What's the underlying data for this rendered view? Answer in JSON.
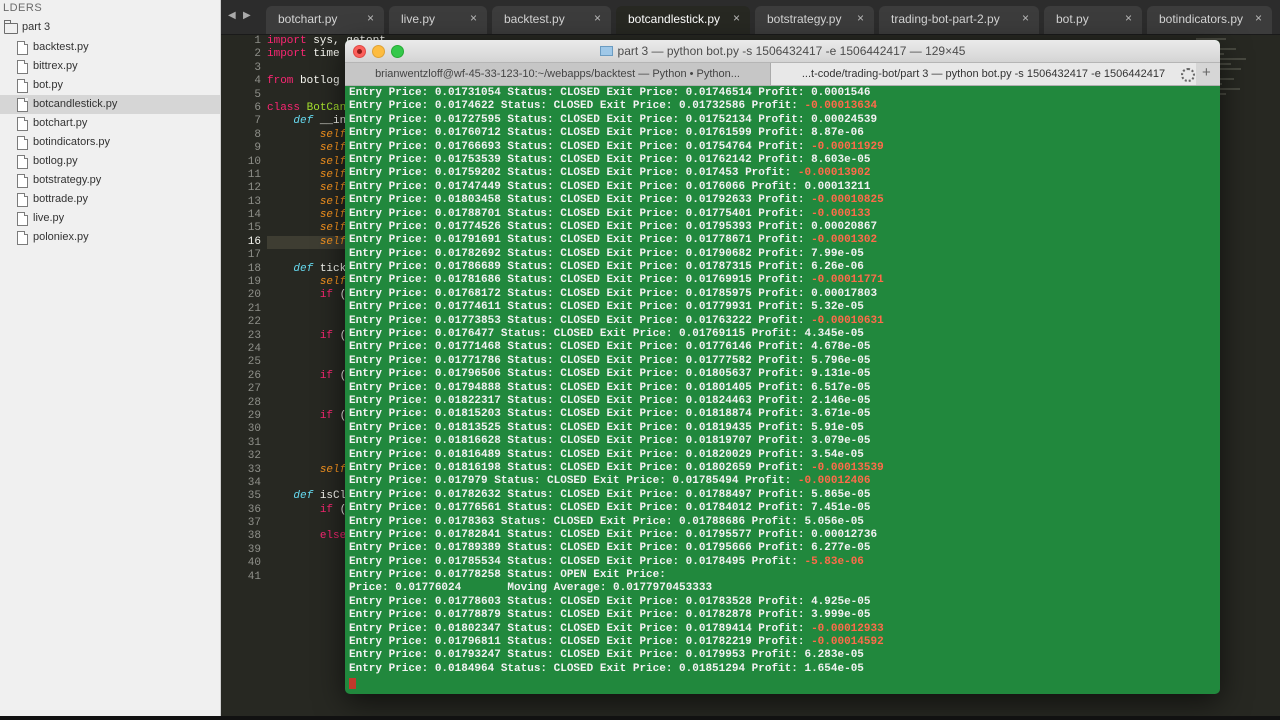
{
  "sidebar": {
    "header": "LDERS",
    "folder": "part 3",
    "files": [
      {
        "label": "backtest.py",
        "active": false
      },
      {
        "label": "bittrex.py",
        "active": false
      },
      {
        "label": "bot.py",
        "active": false
      },
      {
        "label": "botcandlestick.py",
        "active": true
      },
      {
        "label": "botchart.py",
        "active": false
      },
      {
        "label": "botindicators.py",
        "active": false
      },
      {
        "label": "botlog.py",
        "active": false
      },
      {
        "label": "botstrategy.py",
        "active": false
      },
      {
        "label": "bottrade.py",
        "active": false
      },
      {
        "label": "live.py",
        "active": false
      },
      {
        "label": "poloniex.py",
        "active": false
      }
    ]
  },
  "tabs": [
    {
      "label": "botchart.py",
      "active": false
    },
    {
      "label": "live.py",
      "active": false
    },
    {
      "label": "backtest.py",
      "active": false
    },
    {
      "label": "botcandlestick.py",
      "active": true
    },
    {
      "label": "botstrategy.py",
      "active": false
    },
    {
      "label": "trading-bot-part-2.py",
      "active": false
    },
    {
      "label": "bot.py",
      "active": false
    },
    {
      "label": "botindicators.py",
      "active": false
    }
  ],
  "editor": {
    "line_numbers": [
      "1",
      "2",
      "3",
      "4",
      "5",
      "6",
      "7",
      "8",
      "9",
      "10",
      "11",
      "12",
      "13",
      "14",
      "15",
      "16",
      "17",
      "18",
      "19",
      "20",
      "21",
      "22",
      "23",
      "24",
      "25",
      "26",
      "27",
      "28",
      "29",
      "30",
      "31",
      "32",
      "33",
      "34",
      "35",
      "36",
      "37",
      "38",
      "39",
      "40",
      "41"
    ],
    "current_line": "16",
    "code_lines": [
      "import sys, getopt",
      "import time",
      "",
      "from botlog",
      "",
      "class BotCan",
      "    def __in",
      "        self",
      "        self",
      "        self",
      "        self",
      "        self",
      "        self",
      "        self",
      "        self",
      "        self",
      "",
      "    def tick",
      "        self",
      "        if (",
      "",
      "",
      "        if (",
      "",
      "",
      "        if (",
      "",
      "",
      "        if (",
      "",
      "",
      "",
      "        self",
      "",
      "    def isCl",
      "        if (",
      "",
      "        else",
      "",
      "",
      ""
    ]
  },
  "terminal": {
    "title": "part 3 — python bot.py -s 1506432417 -e 1506442417 — 129×45",
    "tab_inactive": "brianwentzloff@wf-45-33-123-10:~/webapps/backtest — Python • Python...",
    "tab_active": "...t-code/trading-bot/part 3 — python bot.py -s 1506432417 -e 1506442417",
    "lines": [
      {
        "text": "Entry Price: 0.01731054 Status: CLOSED Exit Price: 0.01746514 Profit: ",
        "profit": "0.0001546",
        "neg": false
      },
      {
        "text": "Entry Price: 0.0174622 Status: CLOSED Exit Price: 0.01732586 Profit: ",
        "profit": "-0.00013634",
        "neg": true
      },
      {
        "text": "Entry Price: 0.01727595 Status: CLOSED Exit Price: 0.01752134 Profit: ",
        "profit": "0.00024539",
        "neg": false
      },
      {
        "text": "Entry Price: 0.01760712 Status: CLOSED Exit Price: 0.01761599 Profit: ",
        "profit": "8.87e-06",
        "neg": false
      },
      {
        "text": "Entry Price: 0.01766693 Status: CLOSED Exit Price: 0.01754764 Profit: ",
        "profit": "-0.00011929",
        "neg": true
      },
      {
        "text": "Entry Price: 0.01753539 Status: CLOSED Exit Price: 0.01762142 Profit: ",
        "profit": "8.603e-05",
        "neg": false
      },
      {
        "text": "Entry Price: 0.01759202 Status: CLOSED Exit Price: 0.017453 Profit: ",
        "profit": "-0.00013902",
        "neg": true
      },
      {
        "text": "Entry Price: 0.01747449 Status: CLOSED Exit Price: 0.0176066 Profit: ",
        "profit": "0.00013211",
        "neg": false
      },
      {
        "text": "Entry Price: 0.01803458 Status: CLOSED Exit Price: 0.01792633 Profit: ",
        "profit": "-0.00010825",
        "neg": true
      },
      {
        "text": "Entry Price: 0.01788701 Status: CLOSED Exit Price: 0.01775401 Profit: ",
        "profit": "-0.000133",
        "neg": true
      },
      {
        "text": "Entry Price: 0.01774526 Status: CLOSED Exit Price: 0.01795393 Profit: ",
        "profit": "0.00020867",
        "neg": false
      },
      {
        "text": "Entry Price: 0.01791691 Status: CLOSED Exit Price: 0.01778671 Profit: ",
        "profit": "-0.0001302",
        "neg": true
      },
      {
        "text": "Entry Price: 0.01782692 Status: CLOSED Exit Price: 0.01790682 Profit: ",
        "profit": "7.99e-05",
        "neg": false
      },
      {
        "text": "Entry Price: 0.01786689 Status: CLOSED Exit Price: 0.01787315 Profit: ",
        "profit": "6.26e-06",
        "neg": false
      },
      {
        "text": "Entry Price: 0.01781686 Status: CLOSED Exit Price: 0.01769915 Profit: ",
        "profit": "-0.00011771",
        "neg": true
      },
      {
        "text": "Entry Price: 0.01768172 Status: CLOSED Exit Price: 0.01785975 Profit: ",
        "profit": "0.00017803",
        "neg": false
      },
      {
        "text": "Entry Price: 0.01774611 Status: CLOSED Exit Price: 0.01779931 Profit: ",
        "profit": "5.32e-05",
        "neg": false
      },
      {
        "text": "Entry Price: 0.01773853 Status: CLOSED Exit Price: 0.01763222 Profit: ",
        "profit": "-0.00010631",
        "neg": true
      },
      {
        "text": "Entry Price: 0.0176477 Status: CLOSED Exit Price: 0.01769115 Profit: ",
        "profit": "4.345e-05",
        "neg": false
      },
      {
        "text": "Entry Price: 0.01771468 Status: CLOSED Exit Price: 0.01776146 Profit: ",
        "profit": "4.678e-05",
        "neg": false
      },
      {
        "text": "Entry Price: 0.01771786 Status: CLOSED Exit Price: 0.01777582 Profit: ",
        "profit": "5.796e-05",
        "neg": false
      },
      {
        "text": "Entry Price: 0.01796506 Status: CLOSED Exit Price: 0.01805637 Profit: ",
        "profit": "9.131e-05",
        "neg": false
      },
      {
        "text": "Entry Price: 0.01794888 Status: CLOSED Exit Price: 0.01801405 Profit: ",
        "profit": "6.517e-05",
        "neg": false
      },
      {
        "text": "Entry Price: 0.01822317 Status: CLOSED Exit Price: 0.01824463 Profit: ",
        "profit": "2.146e-05",
        "neg": false
      },
      {
        "text": "Entry Price: 0.01815203 Status: CLOSED Exit Price: 0.01818874 Profit: ",
        "profit": "3.671e-05",
        "neg": false
      },
      {
        "text": "Entry Price: 0.01813525 Status: CLOSED Exit Price: 0.01819435 Profit: ",
        "profit": "5.91e-05",
        "neg": false
      },
      {
        "text": "Entry Price: 0.01816628 Status: CLOSED Exit Price: 0.01819707 Profit: ",
        "profit": "3.079e-05",
        "neg": false
      },
      {
        "text": "Entry Price: 0.01816489 Status: CLOSED Exit Price: 0.01820029 Profit: ",
        "profit": "3.54e-05",
        "neg": false
      },
      {
        "text": "Entry Price: 0.01816198 Status: CLOSED Exit Price: 0.01802659 Profit: ",
        "profit": "-0.00013539",
        "neg": true
      },
      {
        "text": "Entry Price: 0.017979 Status: CLOSED Exit Price: 0.01785494 Profit: ",
        "profit": "-0.00012406",
        "neg": true
      },
      {
        "text": "Entry Price: 0.01782632 Status: CLOSED Exit Price: 0.01788497 Profit: ",
        "profit": "5.865e-05",
        "neg": false
      },
      {
        "text": "Entry Price: 0.01776561 Status: CLOSED Exit Price: 0.01784012 Profit: ",
        "profit": "7.451e-05",
        "neg": false
      },
      {
        "text": "Entry Price: 0.0178363 Status: CLOSED Exit Price: 0.01788686 Profit: ",
        "profit": "5.056e-05",
        "neg": false
      },
      {
        "text": "Entry Price: 0.01782841 Status: CLOSED Exit Price: 0.01795577 Profit: ",
        "profit": "0.00012736",
        "neg": false
      },
      {
        "text": "Entry Price: 0.01789389 Status: CLOSED Exit Price: 0.01795666 Profit: ",
        "profit": "6.277e-05",
        "neg": false
      },
      {
        "text": "Entry Price: 0.01785534 Status: CLOSED Exit Price: 0.0178495 Profit: ",
        "profit": "-5.83e-06",
        "neg": true
      },
      {
        "text": "Entry Price: 0.01778258 Status: OPEN Exit Price: ",
        "profit": "",
        "neg": false
      },
      {
        "text": "Price: 0.01776024       Moving Average: 0.0177970453333",
        "profit": "",
        "neg": false
      },
      {
        "text": "Entry Price: 0.01778603 Status: CLOSED Exit Price: 0.01783528 Profit: ",
        "profit": "4.925e-05",
        "neg": false
      },
      {
        "text": "Entry Price: 0.01778879 Status: CLOSED Exit Price: 0.01782878 Profit: ",
        "profit": "3.999e-05",
        "neg": false
      },
      {
        "text": "Entry Price: 0.01802347 Status: CLOSED Exit Price: 0.01789414 Profit: ",
        "profit": "-0.00012933",
        "neg": true
      },
      {
        "text": "Entry Price: 0.01796811 Status: CLOSED Exit Price: 0.01782219 Profit: ",
        "profit": "-0.00014592",
        "neg": true
      },
      {
        "text": "Entry Price: 0.01793247 Status: CLOSED Exit Price: 0.0179953 Profit: ",
        "profit": "6.283e-05",
        "neg": false
      },
      {
        "text": "Entry Price: 0.0184964 Status: CLOSED Exit Price: 0.01851294 Profit: ",
        "profit": "1.654e-05",
        "neg": false
      }
    ]
  }
}
